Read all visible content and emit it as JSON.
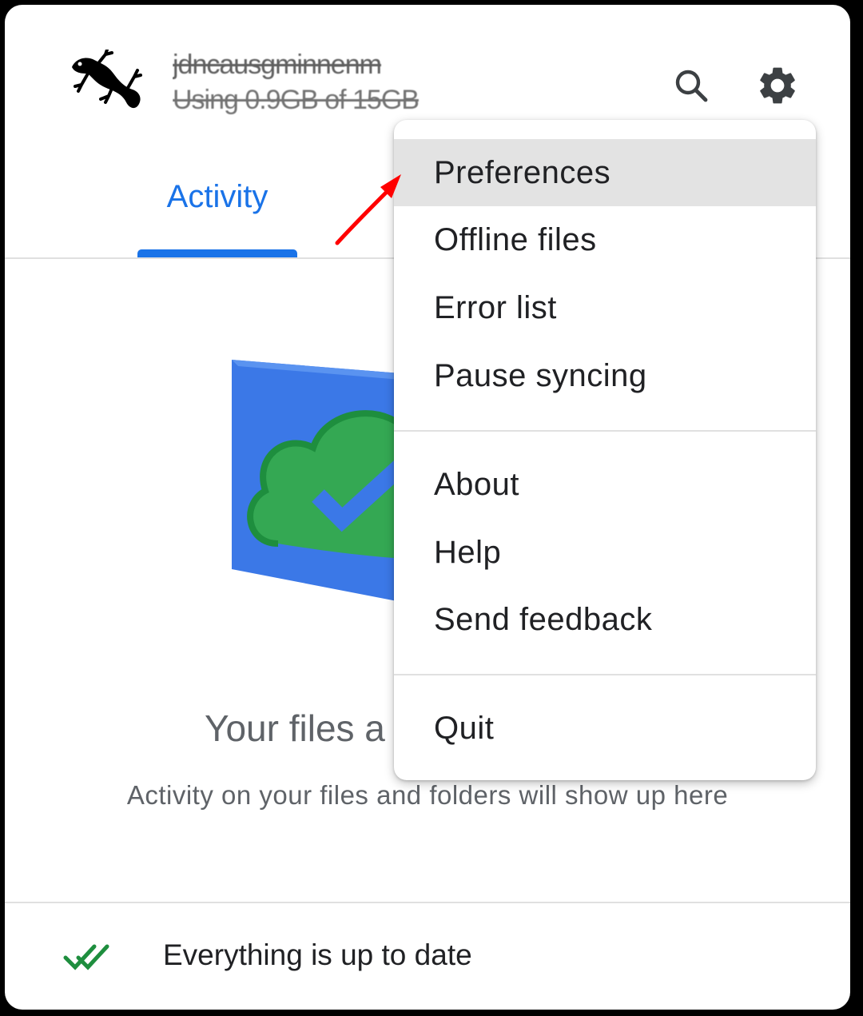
{
  "tabs": {
    "active_label": "Activity"
  },
  "account": {
    "name_redacted": "jdncausgminnenm",
    "storage_redacted": "Using 0.9GB of 15GB"
  },
  "icons": {
    "search": "search-icon",
    "settings": "gear-icon",
    "status": "double-check-icon"
  },
  "empty_state": {
    "title": "Your files a",
    "subtitle": "Activity on your files and folders will show up here"
  },
  "footer": {
    "status": "Everything is up to date"
  },
  "menu": {
    "items": [
      {
        "label": "Preferences"
      },
      {
        "label": "Offline files"
      },
      {
        "label": "Error list"
      },
      {
        "label": "Pause syncing"
      },
      {
        "label": "About"
      },
      {
        "label": "Help"
      },
      {
        "label": "Send feedback"
      },
      {
        "label": "Quit"
      }
    ],
    "highlighted": "Preferences"
  },
  "colors": {
    "accent": "#1a73e8",
    "hover": "#e3e3e3",
    "success": "#1e8e3e",
    "annotation": "#ff0000"
  }
}
